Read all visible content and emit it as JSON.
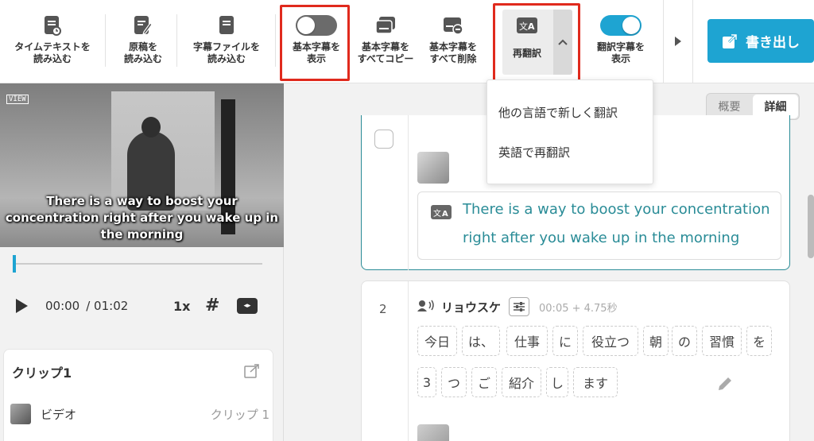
{
  "toolbar": {
    "import_timetext": "タイムテキストを\n読み込む",
    "import_script": "原稿を\n読み込む",
    "import_subtitle_file": "字幕ファイルを\n読み込む",
    "show_base_subtitle": "基本字幕を\n表示",
    "copy_all_base": "基本字幕を\nすべてコピー",
    "delete_all_base": "基本字幕を\nすべて削除",
    "retranslate": "再翻訳",
    "show_translated": "翻訳字幕を\n表示",
    "export": "書き出し",
    "show_base_subtitle_on": false,
    "show_translated_on": true
  },
  "dropdown": {
    "items": [
      "他の言語で新しく翻訳",
      "英語で再翻訳"
    ]
  },
  "video": {
    "subtitle": "There is a way to boost your\nconcentration right after you wake up in\nthe morning",
    "watermark": "VIEW"
  },
  "player": {
    "current": "00:00",
    "duration": "/ 01:02",
    "speed": "1x",
    "progress": 0.0
  },
  "clip": {
    "title": "クリップ1",
    "row_name": "ビデオ",
    "row_meta": "クリップ 1"
  },
  "view_toggle": {
    "summary": "概要",
    "detail": "詳細",
    "active": "detail"
  },
  "entries": [
    {
      "translated_text": "There is a way to boost your concentration right after you wake up in the morning"
    },
    {
      "number": "2",
      "speaker": "リョウスケ",
      "timestamp": "00:05 + 4.75秒",
      "words": [
        "今日",
        "は、",
        "仕事",
        "に",
        "役立つ",
        "朝",
        "の",
        "習慣",
        "を",
        "3",
        "つ",
        "ご",
        "紹介",
        "し",
        "ます"
      ]
    }
  ],
  "colors": {
    "accent": "#1ea4d2",
    "teal": "#2a8c97",
    "highlight": "#e02a1d"
  }
}
